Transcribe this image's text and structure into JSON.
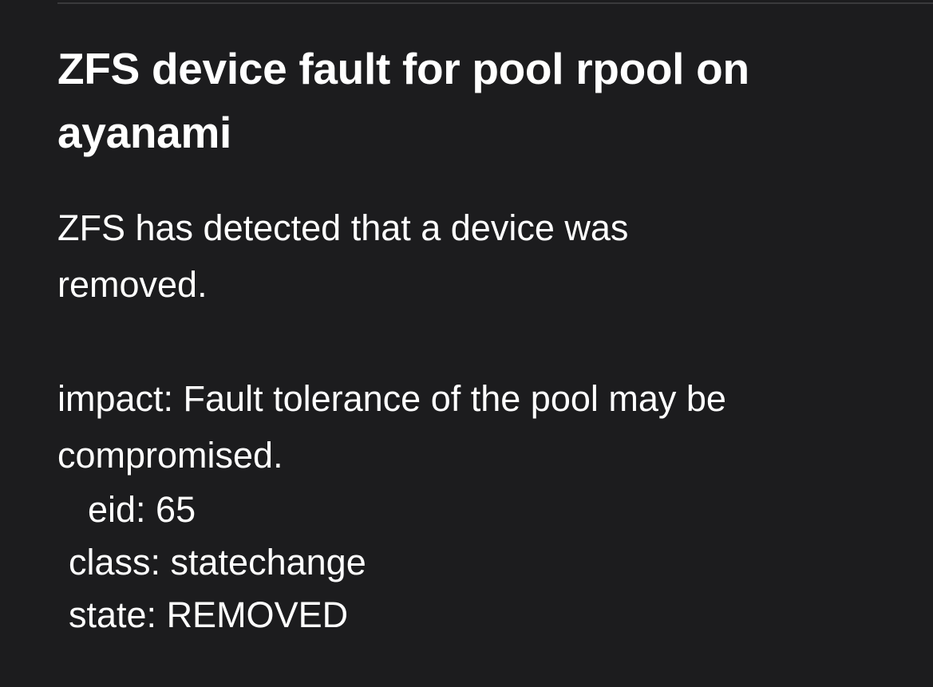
{
  "notification": {
    "title": "ZFS device fault for pool rpool on ayanami",
    "summary": "ZFS has detected that a device was removed.",
    "impact": "impact: Fault tolerance of the pool may be compromised.",
    "fields": {
      "eid": "eid: 65",
      "class": "class: statechange",
      "state": "state: REMOVED"
    }
  },
  "colors": {
    "background": "#1c1c1e",
    "text": "#ffffff",
    "divider": "#3a3a3c"
  }
}
